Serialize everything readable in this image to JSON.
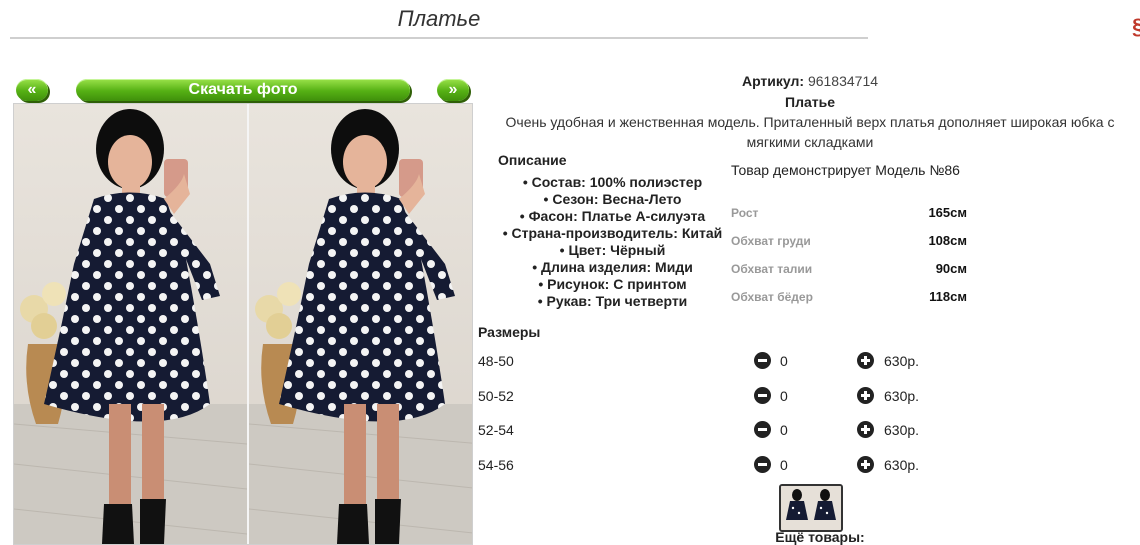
{
  "page": {
    "title": "Платье"
  },
  "gallery": {
    "prev_label": "«",
    "download_label": "Скачать фото",
    "next_label": "»"
  },
  "product": {
    "article_label": "Артикул:",
    "article_value": "961834714",
    "name": "Платье",
    "description": "Очень удобная и женственная модель. Приталенный верх платья дополняет широкая юбка с мягкими складками"
  },
  "specs": {
    "heading": "Описание",
    "items": [
      "Состав: 100% полиэстер",
      "Сезон: Весна-Лето",
      "Фасон: Платье А-силуэта",
      "Страна-производитель: Китай",
      "Цвет: Чёрный",
      "Длина изделия: Миди",
      "Рисунок: С принтом",
      "Рукав: Три четверти"
    ]
  },
  "model": {
    "caption": "Товар демонстрирует Модель №86",
    "measures": [
      {
        "label": "Рост",
        "value": "165см"
      },
      {
        "label": "Обхват груди",
        "value": "108см"
      },
      {
        "label": "Обхват талии",
        "value": "90см"
      },
      {
        "label": "Обхват бёдер",
        "value": "118см"
      }
    ]
  },
  "sizes": {
    "heading": "Размеры",
    "rows": [
      {
        "size": "48-50",
        "qty": "0",
        "price": "630р."
      },
      {
        "size": "50-52",
        "qty": "0",
        "price": "630р."
      },
      {
        "size": "52-54",
        "qty": "0",
        "price": "630р."
      },
      {
        "size": "54-56",
        "qty": "0",
        "price": "630р."
      }
    ]
  },
  "footer": {
    "more_label": "Ещё товары:"
  },
  "colors": {
    "accent_green": "#55b014",
    "dress_navy": "#151b33"
  },
  "icons": {
    "minus": "minus-circle-icon",
    "plus": "plus-circle-icon"
  }
}
